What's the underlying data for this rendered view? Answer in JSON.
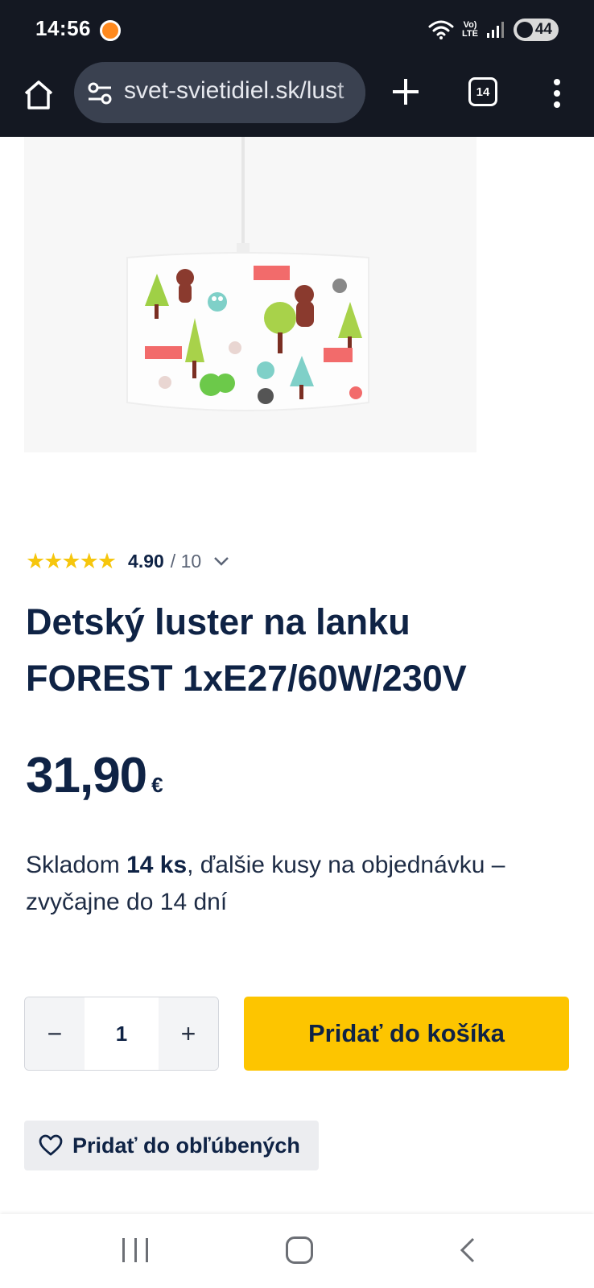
{
  "status_bar": {
    "time": "14:56",
    "volte_label_top": "Vo)",
    "volte_label_bottom": "LTE",
    "battery": "44"
  },
  "browser": {
    "url": "svet-svietidiel.sk/lust",
    "tab_count": "14",
    "icons": [
      "home-icon",
      "site-settings-icon",
      "plus-icon",
      "tabs-icon",
      "more-vert-icon"
    ]
  },
  "product": {
    "rating_stars": "★★★★★",
    "rating_value": "4.90",
    "rating_max": "/ 10",
    "title": "Detský luster na lanku FOREST 1xE27/60W/230V",
    "price_value": "31,90",
    "price_currency": "€",
    "stock_prefix": "Skladom ",
    "stock_count": "14 ks",
    "stock_suffix": ", ďalšie kusy na objednávku – zvyčajne do 14 dní"
  },
  "purchase": {
    "qty_minus": "−",
    "qty_value": "1",
    "qty_plus": "+",
    "add_to_cart_label": "Pridať do košíka",
    "favorite_label": "Pridať do obľúbených"
  },
  "colors": {
    "status_bg": "#141822",
    "brand_navy": "#0f2345",
    "cta_yellow": "#fdc500",
    "star_yellow": "#f6c60d"
  }
}
